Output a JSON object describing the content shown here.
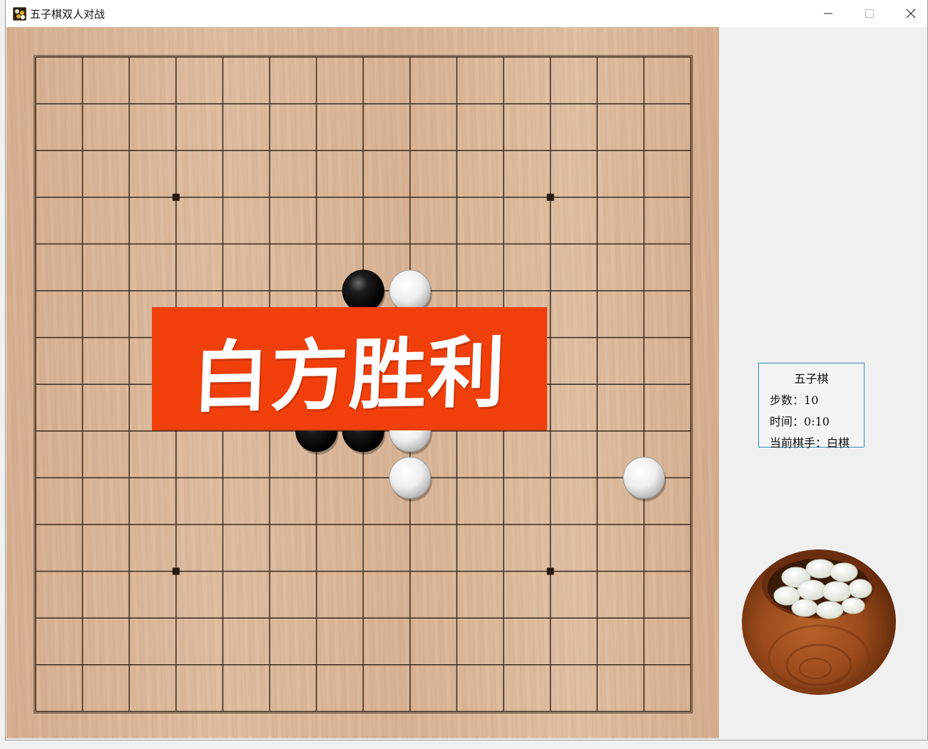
{
  "window": {
    "title": "五子棋双人对战",
    "controls": [
      "minimize",
      "maximize",
      "close"
    ]
  },
  "board": {
    "size": 15,
    "star_points": [
      [
        3,
        3
      ],
      [
        3,
        11
      ],
      [
        11,
        3
      ],
      [
        11,
        11
      ]
    ],
    "stones": [
      {
        "row": 5,
        "col": 7,
        "color": "black"
      },
      {
        "row": 5,
        "col": 8,
        "color": "white"
      },
      {
        "row": 8,
        "col": 6,
        "color": "black"
      },
      {
        "row": 8,
        "col": 7,
        "color": "black"
      },
      {
        "row": 8,
        "col": 8,
        "color": "white"
      },
      {
        "row": 9,
        "col": 8,
        "color": "white"
      },
      {
        "row": 9,
        "col": 13,
        "color": "white"
      }
    ]
  },
  "banner": {
    "text": "白方胜利",
    "color": "#f13f0b"
  },
  "info": {
    "title": "五子棋",
    "steps_label": "步数：",
    "steps_value": "10",
    "time_label": "时间：",
    "time_value": "0:10",
    "player_label": "当前棋手：",
    "player_value": "白棋"
  },
  "bowl": {
    "icon": "stone-bowl-icon",
    "stone_color": "white"
  }
}
